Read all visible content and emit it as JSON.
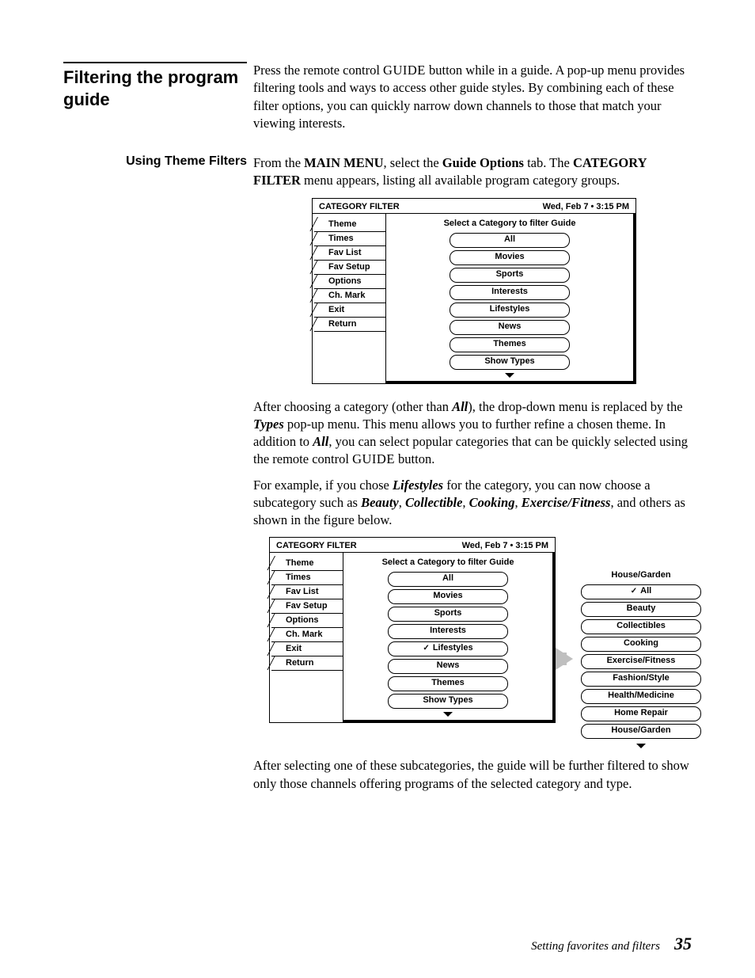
{
  "section_title": "Filtering the program guide",
  "intro_1a": "Press the remote control ",
  "intro_1b": "GUIDE",
  "intro_1c": " button while in a guide. A pop-up menu provides filtering tools and ways to access other guide styles. By combining each of these filter options, you can quickly narrow down channels to those that match your viewing interests.",
  "sub1": "Using Theme Filters",
  "sub1_p_a": "From the ",
  "sub1_p_b": "MAIN MENU",
  "sub1_p_c": ", select the ",
  "sub1_p_d": "Guide Options",
  "sub1_p_e": " tab. The ",
  "sub1_p_f": "CATEGORY FILTER",
  "sub1_p_g": " menu appears, listing all available program category groups.",
  "panel_title": "CATEGORY FILTER",
  "panel_time": "Wed, Feb 7  •  3:15 PM",
  "tabs": [
    "Theme",
    "Times",
    "Fav List",
    "Fav Setup",
    "Options",
    "Ch. Mark",
    "Exit",
    "Return"
  ],
  "hint": "Select a Category to filter Guide",
  "cats": [
    "All",
    "Movies",
    "Sports",
    "Interests",
    "Lifestyles",
    "News",
    "Themes",
    "Show Types"
  ],
  "mid_p1_a": "After choosing a category (other than ",
  "mid_p1_b": "All",
  "mid_p1_c": "), the drop-down menu is replaced by the ",
  "mid_p1_d": "Types",
  "mid_p1_e": " pop-up menu. This menu allows you to further refine a chosen theme. In addition to ",
  "mid_p1_f": "All",
  "mid_p1_g": ", you can select popular categories that can be quickly selected using the remote control ",
  "mid_p1_h": "GUIDE",
  "mid_p1_i": " button.",
  "mid_p2_a": "For example, if you chose ",
  "mid_p2_b": "Lifestyles",
  "mid_p2_c": " for the category, you can now choose a subcategory such as ",
  "mid_p2_d": "Beauty",
  "mid_p2_e": ", ",
  "mid_p2_f": "Collectible",
  "mid_p2_g": ", ",
  "mid_p2_h": "Cooking",
  "mid_p2_i": ", ",
  "mid_p2_j": "Exercise/Fitness",
  "mid_p2_k": ", and others as shown in the figure below.",
  "check": "✓",
  "pop_head": "House/Garden",
  "subcats": [
    "All",
    "Beauty",
    "Collectibles",
    "Cooking",
    "Exercise/Fitness",
    "Fashion/Style",
    "Health/Medicine",
    "Home Repair",
    "House/Garden"
  ],
  "end_p": "After selecting one of these subcategories, the guide will be further filtered to show only those channels offering programs of the selected category and type.",
  "footer_text": "Setting favorites and filters",
  "page_no": "35"
}
